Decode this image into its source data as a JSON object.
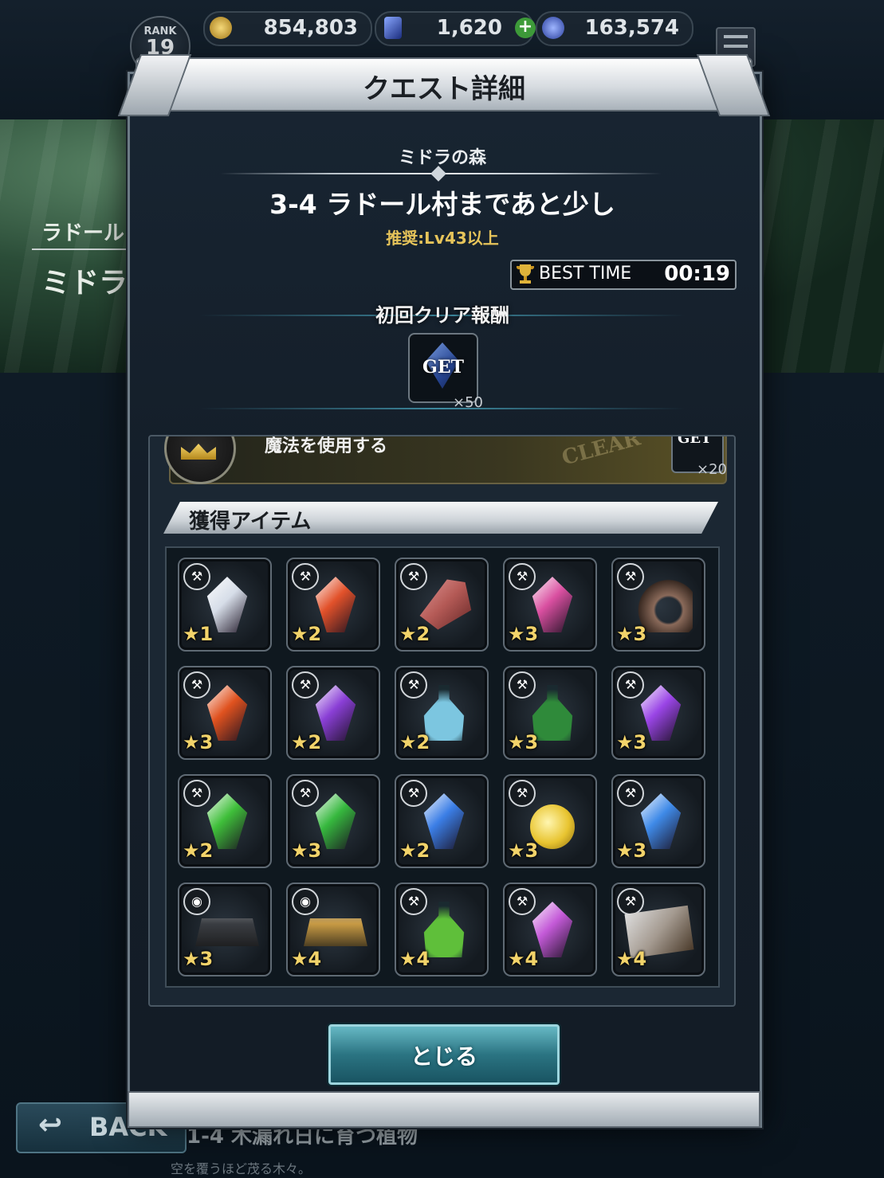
{
  "header": {
    "rank_label": "RANK",
    "rank_value": "19",
    "gil": "854,803",
    "lapis": "1,620",
    "stamina": "163,574"
  },
  "background": {
    "area_label": "ラドール",
    "area_title": "ミドラ",
    "back_label": "BACK",
    "next_quest": "1-4 木漏れ日に育つ植物",
    "next_quest_sub": "空を覆うほど茂る木々。"
  },
  "dialog": {
    "title": "クエスト詳細",
    "area_name": "ミドラの森",
    "quest_name": "3-4 ラドール村まであと少し",
    "recommend": "推奨:Lv43以上",
    "best_time_label": "BEST TIME",
    "best_time_value": "00:19",
    "first_clear_label": "初回クリア報酬",
    "first_clear_reward": {
      "label": "GET",
      "count": "×50"
    },
    "mission": {
      "text": "魔法を使用する",
      "stamp": "CLEAR",
      "reward_label": "GET",
      "reward_count": "×20"
    },
    "items_header": "獲得アイテム",
    "close_label": "とじる"
  },
  "items": [
    {
      "icon": "gear-badge",
      "image": "light-crystal",
      "rarity": "1",
      "color": "#d6dde8"
    },
    {
      "icon": "gear-badge",
      "image": "fire-crystal",
      "rarity": "2",
      "color": "#e2512a"
    },
    {
      "icon": "gear-badge",
      "image": "raw-meat",
      "rarity": "2",
      "color": "#b45a56"
    },
    {
      "icon": "gear-badge",
      "image": "rainbow-crystal",
      "rarity": "3",
      "color": "#d94fa0"
    },
    {
      "icon": "gear-badge",
      "image": "horn",
      "rarity": "3",
      "color": "#8a6a5a"
    },
    {
      "icon": "gear-badge",
      "image": "fire-megacrystal",
      "rarity": "3",
      "color": "#e0521f"
    },
    {
      "icon": "gear-badge",
      "image": "dark-crystal",
      "rarity": "2",
      "color": "#8a3fd6"
    },
    {
      "icon": "gear-badge",
      "image": "water-bottle",
      "rarity": "2",
      "color": "#7cc6e0"
    },
    {
      "icon": "gear-badge",
      "image": "green-potion",
      "rarity": "3",
      "color": "#2f8a3a"
    },
    {
      "icon": "gear-badge",
      "image": "dark-megacrystal",
      "rarity": "3",
      "color": "#9a45e6"
    },
    {
      "icon": "gear-badge",
      "image": "wind-crystal",
      "rarity": "2",
      "color": "#3fbf3a"
    },
    {
      "icon": "gear-badge",
      "image": "wind-megacrystal",
      "rarity": "3",
      "color": "#36b83e"
    },
    {
      "icon": "gear-badge",
      "image": "water-crystal",
      "rarity": "2",
      "color": "#3b7ee6"
    },
    {
      "icon": "gear-badge",
      "image": "golden-apple",
      "rarity": "3",
      "color": "#e8c430"
    },
    {
      "icon": "gear-badge",
      "image": "water-megacrystal",
      "rarity": "3",
      "color": "#3f8ae8"
    },
    {
      "icon": "ingot-badge",
      "image": "dark-ingot",
      "rarity": "3",
      "color": "#3a3d42"
    },
    {
      "icon": "ingot-badge",
      "image": "gold-ingot",
      "rarity": "4",
      "color": "#c79a44"
    },
    {
      "icon": "gear-badge",
      "image": "elixir-bottle",
      "rarity": "4",
      "color": "#5fbf3a"
    },
    {
      "icon": "gear-badge",
      "image": "prism-crystal",
      "rarity": "4",
      "color": "#c45ad8"
    },
    {
      "icon": "gear-badge",
      "image": "ancient-map",
      "rarity": "4",
      "color": "#a49a90"
    }
  ]
}
